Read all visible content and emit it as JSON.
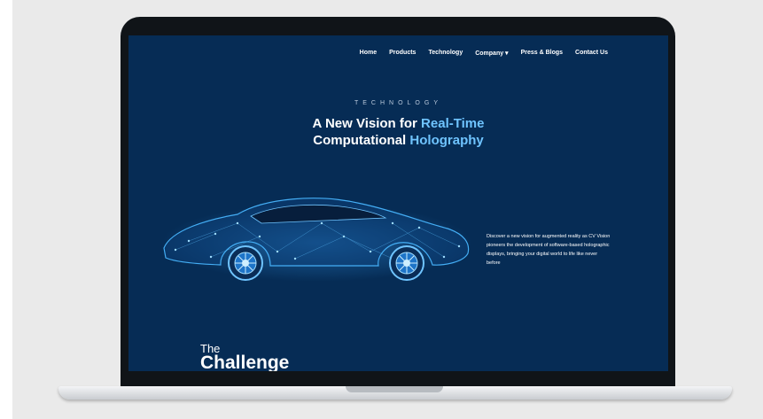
{
  "nav": {
    "items": [
      {
        "label": "Home"
      },
      {
        "label": "Products"
      },
      {
        "label": "Technology"
      },
      {
        "label": "Company ▾"
      },
      {
        "label": "Press & Blogs"
      },
      {
        "label": "Contact Us"
      }
    ]
  },
  "hero": {
    "eyebrow": "TECHNOLOGY",
    "title_line1_plain": "A New Vision for ",
    "title_line1_highlight": "Real-Time",
    "title_line2_plain": "Computational ",
    "title_line2_highlight": "Holography",
    "description": "Discover a new vision for augmented reality as CV Vision pioneers the development of software-based holographic displays, bringing your digital world to life like never before"
  },
  "challenge": {
    "small": "The",
    "big": "Challenge"
  },
  "colors": {
    "screen_bg": "#062c55",
    "accent": "#6fc4ff",
    "device_frame": "#101418"
  },
  "icons": {
    "car": "holographic-car-illustration"
  }
}
